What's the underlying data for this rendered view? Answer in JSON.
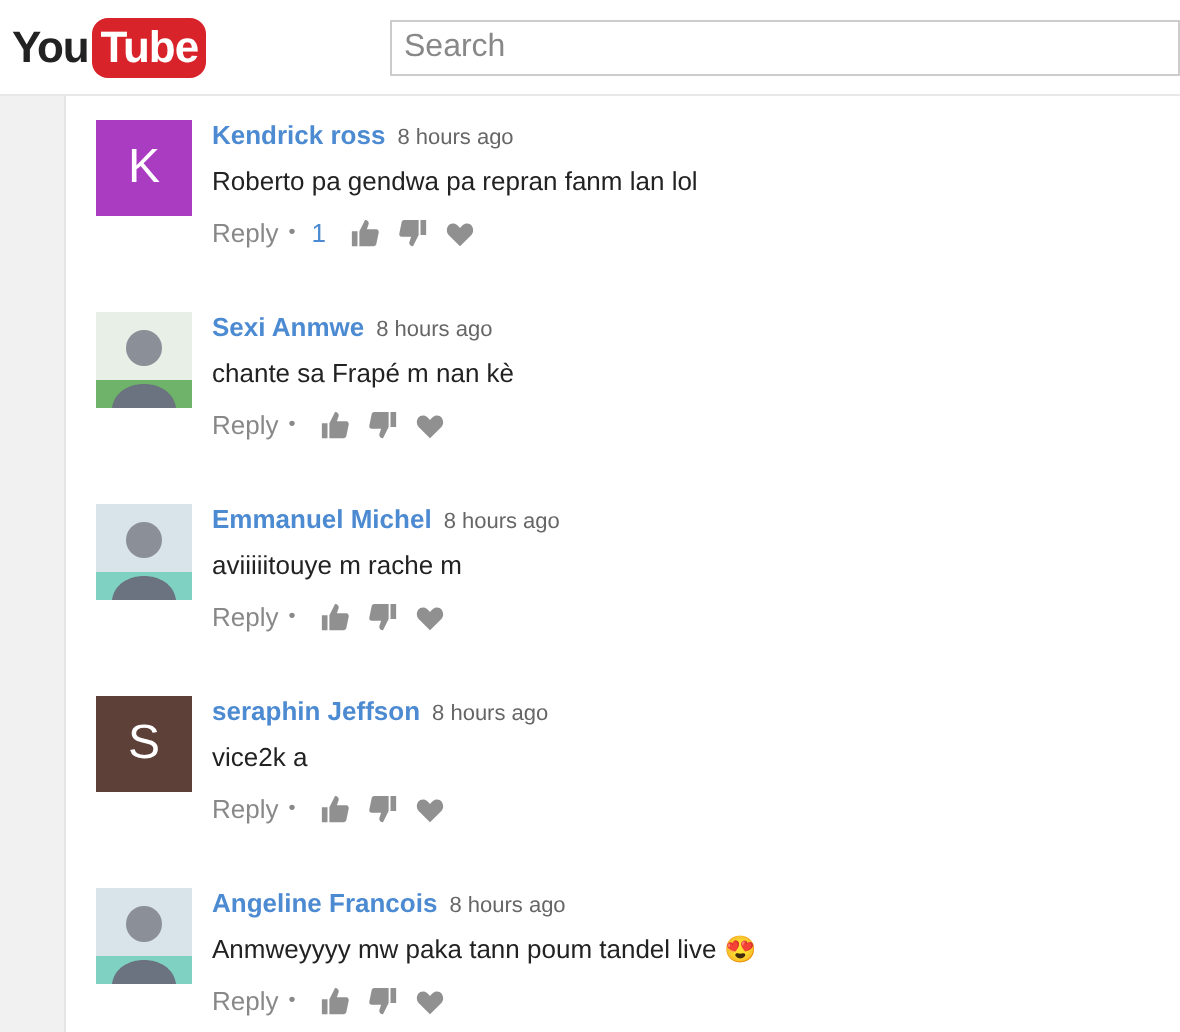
{
  "logo": {
    "part_1": "You",
    "part_2": "Tube"
  },
  "search": {
    "placeholder": "Search"
  },
  "comments": [
    {
      "author": "Kendrick ross",
      "time": "8 hours ago",
      "text": "Roberto pa gendwa pa repran fanm lan lol",
      "reply": "Reply",
      "separator": "•",
      "likes": "1",
      "avatar": {
        "kind": "letter",
        "letter": "K",
        "color": "#a93cc0"
      }
    },
    {
      "author": "Sexi Anmwe",
      "time": "8 hours ago",
      "text": "chante sa Frapé m nan kè",
      "reply": "Reply",
      "separator": "•"
    },
    {
      "author": "Emmanuel Michel",
      "time": "8 hours ago",
      "text": "aviiiiitouye m rache m",
      "reply": "Reply",
      "separator": "•"
    },
    {
      "author": "seraphin Jeffson",
      "time": "8 hours ago",
      "text": "vice2k a",
      "reply": "Reply",
      "separator": "•",
      "avatar": {
        "kind": "letter",
        "letter": "S",
        "color": "#5d4037"
      }
    },
    {
      "author": "Angeline Francois",
      "time": "8 hours ago",
      "text": "Anmweyyyy mw paka tann poum tandel live 😍",
      "reply": "Reply",
      "separator": "•"
    }
  ]
}
